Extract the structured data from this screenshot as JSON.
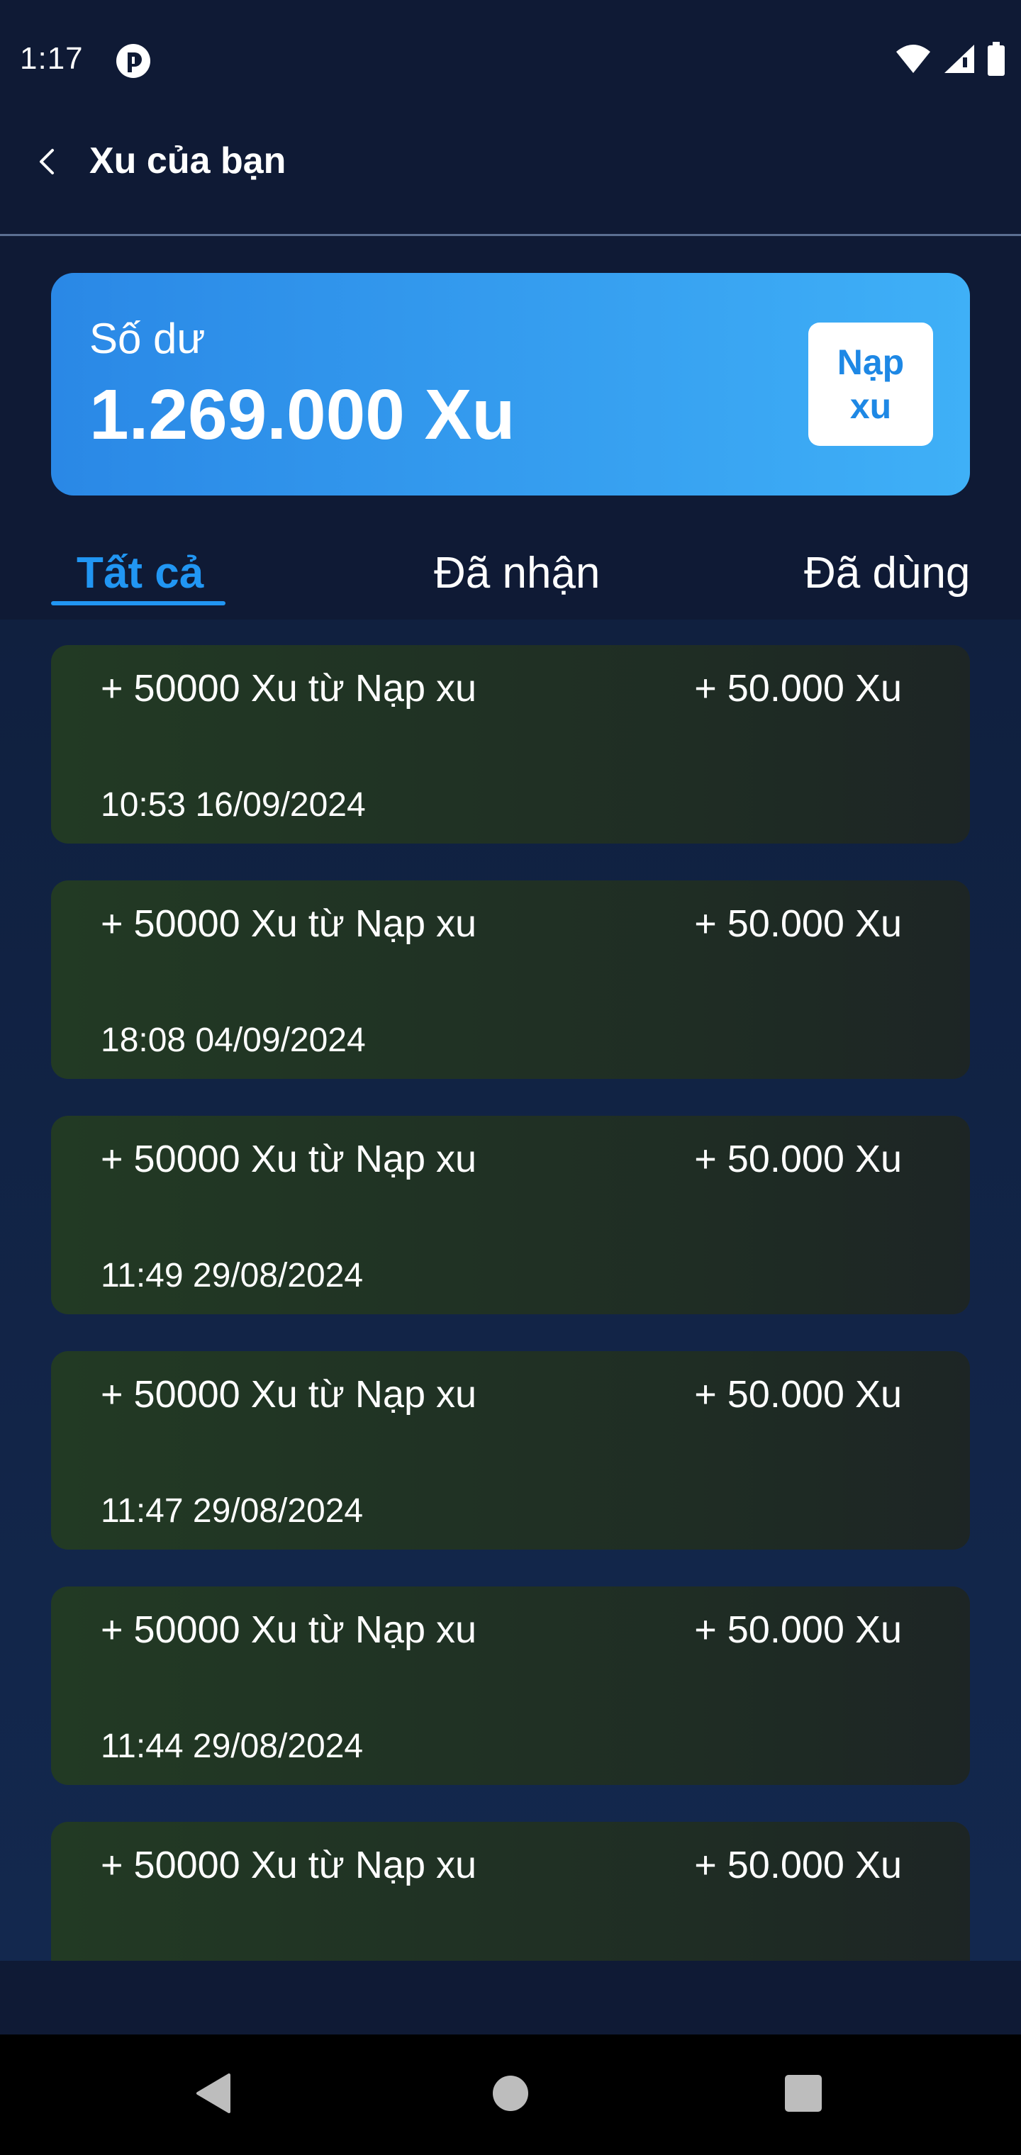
{
  "status_bar": {
    "time": "1:17"
  },
  "app_bar": {
    "title": "Xu của bạn"
  },
  "balance": {
    "label": "Số dư",
    "amount": "1.269.000 Xu",
    "topup_line1": "Nạp",
    "topup_line2": "xu"
  },
  "tabs": [
    {
      "label": "Tất cả",
      "active": true
    },
    {
      "label": "Đã nhận",
      "active": false
    },
    {
      "label": "Đã dùng",
      "active": false
    }
  ],
  "transactions": [
    {
      "title": "+ 50000 Xu từ Nạp xu",
      "amount": "+ 50.000 Xu",
      "time": "10:53 16/09/2024"
    },
    {
      "title": "+ 50000 Xu từ Nạp xu",
      "amount": "+ 50.000 Xu",
      "time": "18:08 04/09/2024"
    },
    {
      "title": "+ 50000 Xu từ Nạp xu",
      "amount": "+ 50.000 Xu",
      "time": "11:49 29/08/2024"
    },
    {
      "title": "+ 50000 Xu từ Nạp xu",
      "amount": "+ 50.000 Xu",
      "time": "11:47 29/08/2024"
    },
    {
      "title": "+ 50000 Xu từ Nạp xu",
      "amount": "+ 50.000 Xu",
      "time": "11:44 29/08/2024"
    },
    {
      "title": "+ 50000 Xu từ Nạp xu",
      "amount": "+ 50.000 Xu",
      "time": ""
    }
  ],
  "colors": {
    "background": "#0f1a35",
    "accent": "#2196f3",
    "card_gradient_start": "#2a88e6",
    "card_gradient_end": "#3fb0f7",
    "transaction_card": "#223a24"
  }
}
